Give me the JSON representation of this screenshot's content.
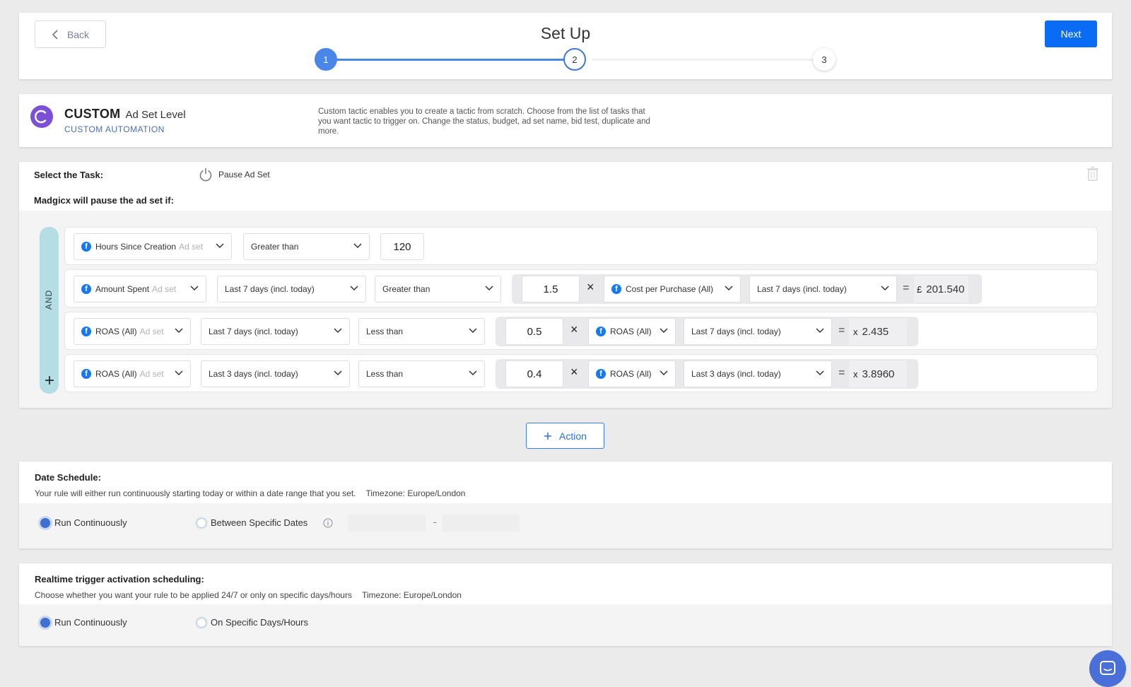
{
  "header": {
    "back_label": "Back",
    "title": "Set Up",
    "next_label": "Next",
    "steps": [
      "1",
      "2",
      "3"
    ],
    "current_step": 2,
    "progress_color": "#4a86e8"
  },
  "tactic": {
    "name": "CUSTOM",
    "level": "Ad Set Level",
    "subtitle": "CUSTOM AUTOMATION",
    "description": "Custom tactic enables you to create a tactic from scratch. Choose from the list of tasks that you want tactic to trigger on. Change the status, budget, ad set name, bid test, duplicate and more."
  },
  "task": {
    "label": "Select the Task:",
    "chip": "Pause Ad Set",
    "condition_label": "Madgicx will pause the ad set if:",
    "operator": "AND",
    "rules": [
      {
        "metric": "Hours Since Creation",
        "metric_level": "Ad set",
        "comparator": "Greater than",
        "value": "120"
      },
      {
        "metric": "Amount Spent",
        "metric_level": "Ad set",
        "period": "Last 7 days (incl. today)",
        "comparator": "Greater than",
        "multiplier": "1.5",
        "ref_metric": "Cost per Purchase (All)",
        "ref_period": "Last 7 days (incl. today)",
        "result_unit": "£",
        "result": "201.540"
      },
      {
        "metric": "ROAS (All)",
        "metric_level": "Ad set",
        "period": "Last 7 days (incl. today)",
        "comparator": "Less than",
        "multiplier": "0.5",
        "ref_metric": "ROAS (All)",
        "ref_period": "Last 7 days (incl. today)",
        "result_unit": "x",
        "result": "2.435"
      },
      {
        "metric": "ROAS (All)",
        "metric_level": "Ad set",
        "period": "Last 3 days (incl. today)",
        "comparator": "Less than",
        "multiplier": "0.4",
        "ref_metric": "ROAS (All)",
        "ref_period": "Last 3 days (incl. today)",
        "result_unit": "x",
        "result": "3.8960"
      }
    ],
    "add_condition": "+",
    "times_symbol": "×",
    "equals_symbol": "="
  },
  "action": {
    "label": "Action"
  },
  "date_schedule": {
    "title": "Date Schedule:",
    "description": "Your rule will either run continuously starting today or within a date range that you set.",
    "timezone": "Timezone: Europe/London",
    "option_1": "Run Continuously",
    "option_2": "Between Specific Dates",
    "range_separator": "-"
  },
  "realtime_schedule": {
    "title": "Realtime trigger activation scheduling:",
    "description": "Choose whether you want your rule to be applied 24/7 or only on specific days/hours",
    "timezone": "Timezone: Europe/London",
    "option_1": "Run Continuously",
    "option_2": "On Specific Days/Hours"
  },
  "icons": {
    "back": "chevron-left-icon",
    "power": "power-icon",
    "trash": "trash-icon",
    "facebook": "facebook-icon",
    "chevron": "chevron-down-icon",
    "info": "info-icon",
    "chat": "chat-icon"
  }
}
